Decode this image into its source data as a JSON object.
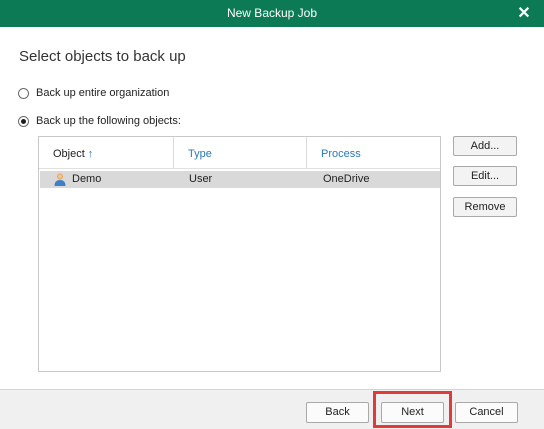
{
  "window": {
    "title": "New Backup Job",
    "close_icon": "close-icon"
  },
  "heading": "Select objects to back up",
  "options": [
    {
      "label": "Back up entire organization",
      "selected": false
    },
    {
      "label": "Back up the following objects:",
      "selected": true
    }
  ],
  "table": {
    "columns": [
      "Object",
      "Type",
      "Process"
    ],
    "sort_indicator": "↑",
    "rows": [
      {
        "object": "Demo",
        "type": "User",
        "process": "OneDrive",
        "icon": "user-icon",
        "selected": true
      }
    ]
  },
  "side_buttons": {
    "add": "Add...",
    "edit": "Edit...",
    "remove": "Remove"
  },
  "footer": {
    "back": "Back",
    "next": "Next",
    "cancel": "Cancel"
  },
  "colors": {
    "titlebar": "#0b7a55",
    "highlight": "#e03b3b",
    "header_link": "#2a7ab8"
  }
}
